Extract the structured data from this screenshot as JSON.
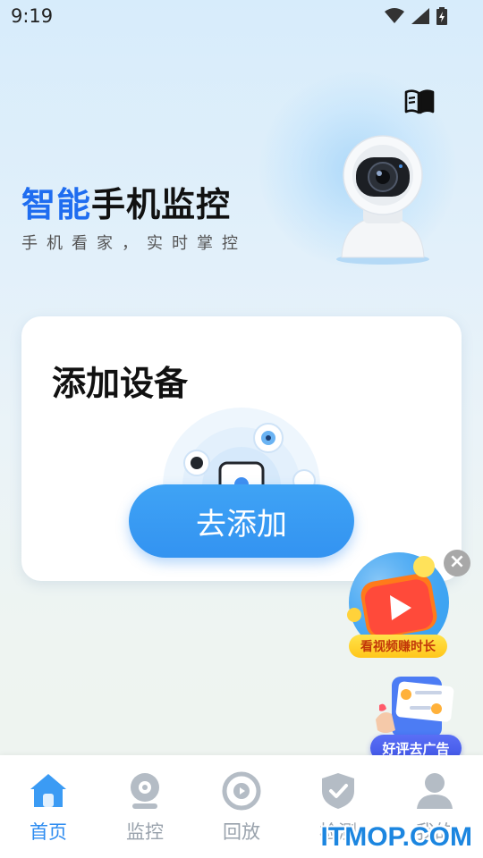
{
  "status_bar": {
    "time": "9:19"
  },
  "hero": {
    "title_accent": "智能",
    "title_rest": "手机监控",
    "subtitle": "手机看家，实时掌控"
  },
  "card": {
    "title": "添加设备",
    "button_label": "去添加"
  },
  "floating_ad": {
    "label": "看视频赚时长",
    "close_symbol": "×"
  },
  "review": {
    "label": "好评去广告"
  },
  "tabs": [
    {
      "label": "首页",
      "icon": "home-icon",
      "active": true
    },
    {
      "label": "监控",
      "icon": "camera-icon",
      "active": false
    },
    {
      "label": "回放",
      "icon": "replay-icon",
      "active": false
    },
    {
      "label": "检测",
      "icon": "shield-icon",
      "active": false
    },
    {
      "label": "我的",
      "icon": "user-icon",
      "active": false
    }
  ],
  "watermark": "ITMOP.COM",
  "colors": {
    "accent": "#1f6df0",
    "button": "#3393f1",
    "tab_active": "#2e8cf0",
    "tab_inactive": "#9aa3ad"
  }
}
